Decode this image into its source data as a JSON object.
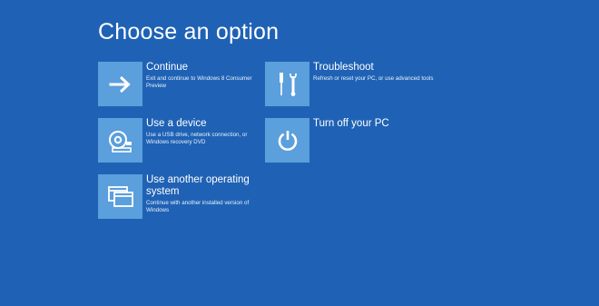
{
  "page": {
    "title": "Choose an option",
    "background": "#1f62b5",
    "tile_color": "#5b9fdc"
  },
  "options": [
    {
      "id": "continue",
      "icon": "arrow-right-icon",
      "title": "Continue",
      "description": "Exit and continue to Windows 8 Consumer Preview"
    },
    {
      "id": "device",
      "icon": "disc-drive-icon",
      "title": "Use a device",
      "description": "Use a USB drive, network connection, or Windows recovery DVD"
    },
    {
      "id": "other-os",
      "icon": "windows-stack-icon",
      "title": "Use another operating system",
      "description": "Continue with another installed version of Windows"
    },
    {
      "id": "troubleshoot",
      "icon": "tools-icon",
      "title": "Troubleshoot",
      "description": "Refresh or reset your PC, or use advanced tools"
    },
    {
      "id": "turn-off",
      "icon": "power-icon",
      "title": "Turn off your PC",
      "description": ""
    }
  ]
}
